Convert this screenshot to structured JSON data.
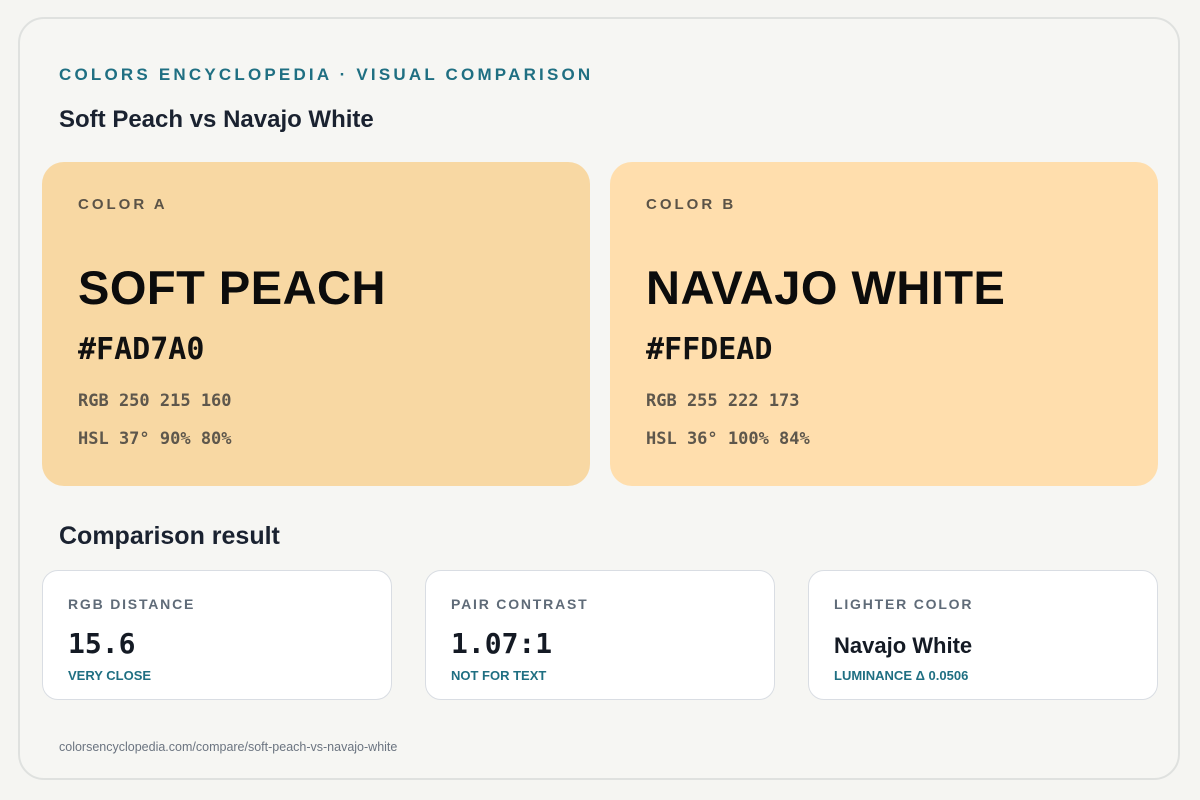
{
  "header": {
    "kicker": "COLORS ENCYCLOPEDIA · VISUAL COMPARISON",
    "title": "Soft Peach vs Navajo White"
  },
  "colors": [
    {
      "label": "COLOR A",
      "name": "SOFT PEACH",
      "hex": "#FAD7A0",
      "rgb": "RGB 250 215 160",
      "hsl": "HSL 37° 90% 80%",
      "swatch_color": "#F8D8A3"
    },
    {
      "label": "COLOR B",
      "name": "NAVAJO WHITE",
      "hex": "#FFDEAD",
      "rgb": "RGB 255 222 173",
      "hsl": "HSL 36° 100% 84%",
      "swatch_color": "#FFDEAD"
    }
  ],
  "comparison": {
    "title": "Comparison result",
    "cards": [
      {
        "label": "RGB DISTANCE",
        "value": "15.6",
        "note": "VERY CLOSE"
      },
      {
        "label": "PAIR CONTRAST",
        "value": "1.07:1",
        "note": "NOT FOR TEXT"
      },
      {
        "label": "LIGHTER COLOR",
        "value": "Navajo White",
        "note": "LUMINANCE Δ 0.0506"
      }
    ]
  },
  "footer": {
    "url": "colorsencyclopedia.com/compare/soft-peach-vs-navajo-white"
  },
  "theme": {
    "accent": "#1F6F82",
    "heading": "#1A2230",
    "background": "#F6F6F3"
  }
}
